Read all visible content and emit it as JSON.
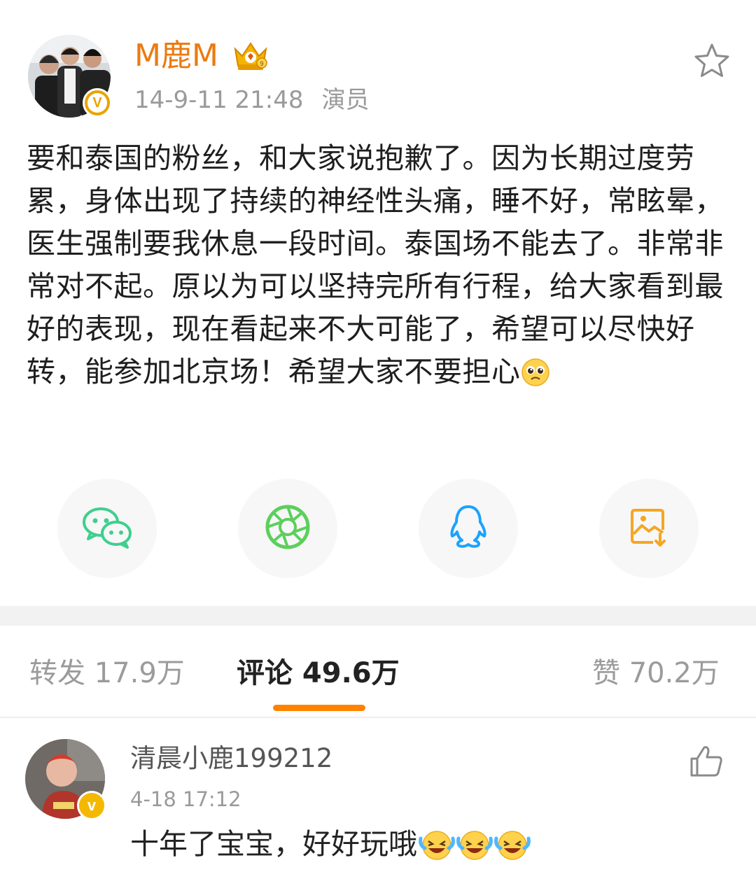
{
  "post": {
    "author": "M鹿M",
    "time": "14-9-11 21:48",
    "source": "演员",
    "content": "要和泰国的粉丝，和大家说抱歉了。因为长期过度劳累，身体出现了持续的神经性头痛，睡不好，常眩晕，医生强制要我休息一段时间。泰国场不能去了。非常非常对不起。原以为可以坚持完所有行程，给大家看到最好的表现，现在看起来不大可能了，希望可以尽快好转，能参加北京场！希望大家不要担心",
    "badge_label": "V",
    "icons": {
      "avatar": "avatar-photo",
      "verified": "verified-badge-icon",
      "level": "crown-level-icon",
      "favorite": "star-icon",
      "emoji": "pleading-face-emoji"
    }
  },
  "share": [
    {
      "name": "wechat",
      "icon": "wechat-icon",
      "color": "#3fcf8e"
    },
    {
      "name": "moments",
      "icon": "moments-aperture-icon",
      "color": "#5ccf5c"
    },
    {
      "name": "qq",
      "icon": "qq-penguin-icon",
      "color": "#1aa3ff"
    },
    {
      "name": "save-image",
      "icon": "save-image-icon",
      "color": "#f5a623"
    }
  ],
  "tabs": {
    "repost": "转发 17.9万",
    "comments": "评论 49.6万",
    "likes": "赞 70.2万",
    "accent": "#ff8200"
  },
  "comment": {
    "user": "清晨小鹿199212",
    "time": "4-18 17:12",
    "text": "十年了宝宝，好好玩哦",
    "badge_label": "v",
    "icons": {
      "like": "thumbs-up-icon",
      "emoji": "laughing-crying-emoji"
    }
  },
  "colors": {
    "author_name": "#ec7a10",
    "meta_gray": "#9a9a9a",
    "verified_gold": "#e9a400"
  }
}
